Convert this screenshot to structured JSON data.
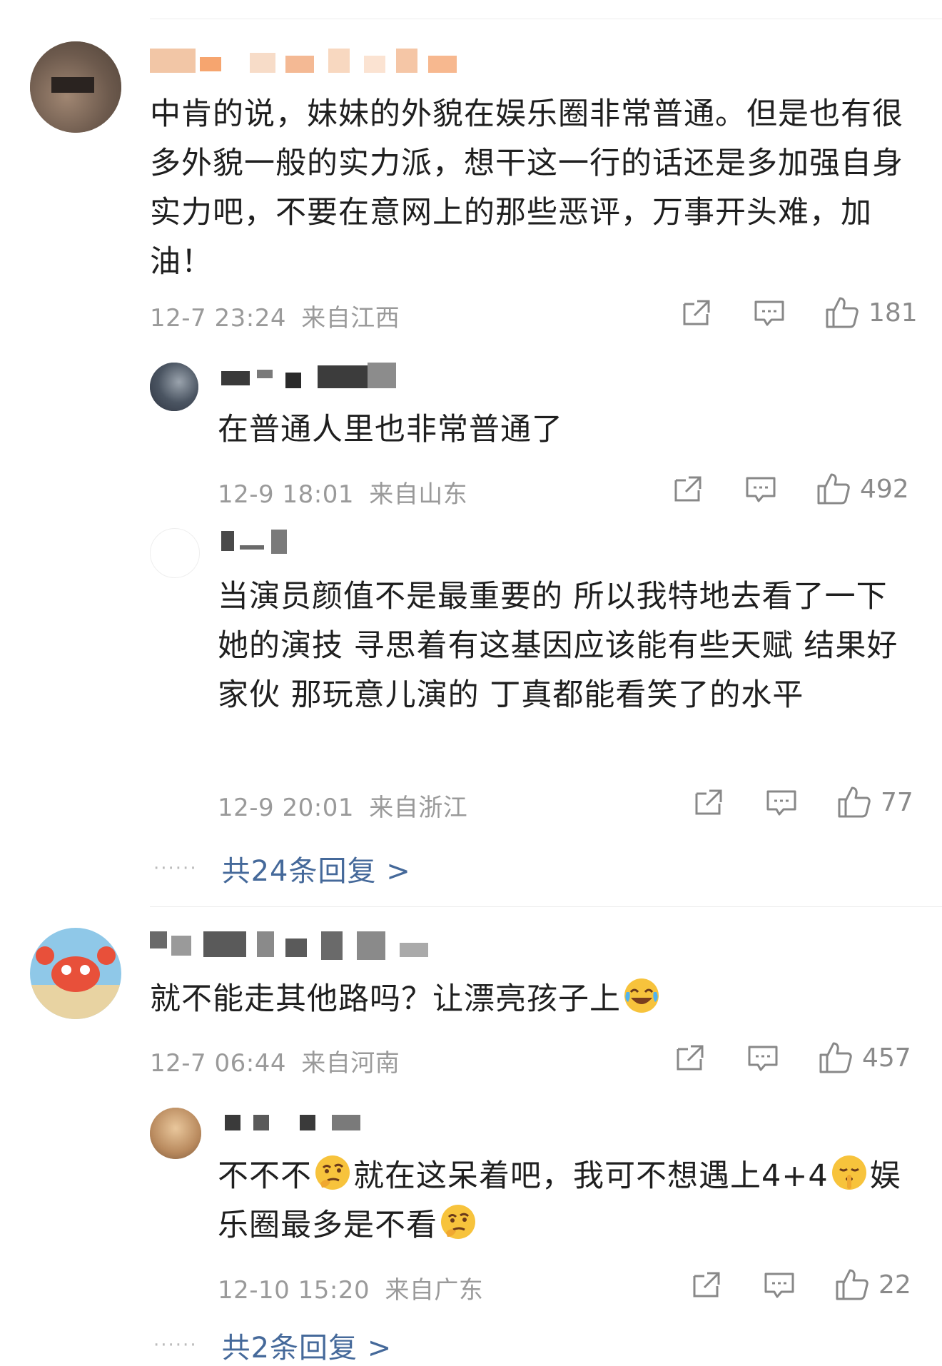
{
  "comments": [
    {
      "text": "中肯的说，妹妹的外貌在娱乐圈非常普通。但是也有很多外貌一般的实力派，想干这一行的话还是多加强自身实力吧，不要在意网上的那些恶评，万事开头难，加油！",
      "time": "12-7 23:24",
      "location": "来自江西",
      "likes": "181",
      "replies": [
        {
          "text": "在普通人里也非常普通了",
          "time": "12-9 18:01",
          "location": "来自山东",
          "likes": "492"
        },
        {
          "text": "当演员颜值不是最重要的 所以我特地去看了一下她的演技 寻思着有这基因应该能有些天赋 结果好家伙 那玩意儿演的 丁真都能看笑了的水平",
          "time": "12-9 20:01",
          "location": "来自浙江",
          "likes": "77"
        }
      ],
      "more_replies": "共24条回复 >"
    },
    {
      "text_parts": [
        "就不能走其他路吗？让漂亮孩子上",
        "😂"
      ],
      "time": "12-7 06:44",
      "location": "来自河南",
      "likes": "457",
      "replies": [
        {
          "text_parts": [
            "不不不",
            "🤔",
            "就在这呆着吧，我可不想遇上4+4",
            "🤫",
            "娱乐圈最多是不看",
            "🤔"
          ],
          "time": "12-10 15:20",
          "location": "来自广东",
          "likes": "22"
        }
      ],
      "more_replies": "共2条回复 >"
    }
  ],
  "icons": {
    "share": "share-icon",
    "comment": "comment-icon",
    "like": "thumbs-up-icon"
  },
  "colors": {
    "link": "#45699a",
    "meta": "#9a9a9a",
    "text": "#1f1f1f"
  }
}
